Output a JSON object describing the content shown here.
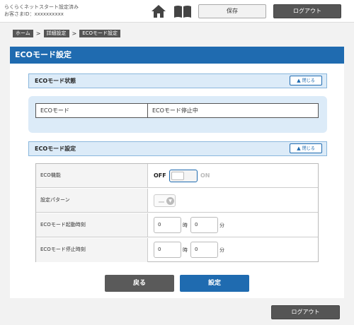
{
  "header": {
    "status_line1": "らくらくネットスタート設定済み",
    "status_line2": "お客さまID：xxxxxxxxxx",
    "save_label": "保存",
    "logout_label": "ログアウト"
  },
  "breadcrumb": {
    "items": [
      "ホーム",
      "詳細設定",
      "ECOモード設定"
    ],
    "separator": ">"
  },
  "page": {
    "title": "ECOモード設定"
  },
  "status_section": {
    "title": "ECOモード状態",
    "toggle_label": "閉じる",
    "row_label": "ECOモード",
    "row_value": "ECOモード停止中"
  },
  "settings_section": {
    "title": "ECOモード設定",
    "toggle_label": "閉じる",
    "eco_label": "ECO機能",
    "eco_off": "OFF",
    "eco_on": "ON",
    "pattern_label": "設定パターン",
    "pattern_value": "ー",
    "start_label": "ECOモード起動時刻",
    "start_hour": "0",
    "start_min": "0",
    "stop_label": "ECOモード停止時刻",
    "stop_hour": "0",
    "stop_min": "0",
    "hour_unit": "時",
    "min_unit": "分"
  },
  "actions": {
    "back_label": "戻る",
    "set_label": "設定"
  },
  "footer": {
    "logout_label": "ログアウト"
  },
  "colors": {
    "accent": "#1f6bb0",
    "section_bg": "#dcebf8",
    "dark_button": "#555555"
  },
  "icons": {
    "home": "home-icon",
    "manual": "book-icon",
    "collapse": "chevron-up-icon",
    "dropdown": "chevron-down-icon"
  }
}
